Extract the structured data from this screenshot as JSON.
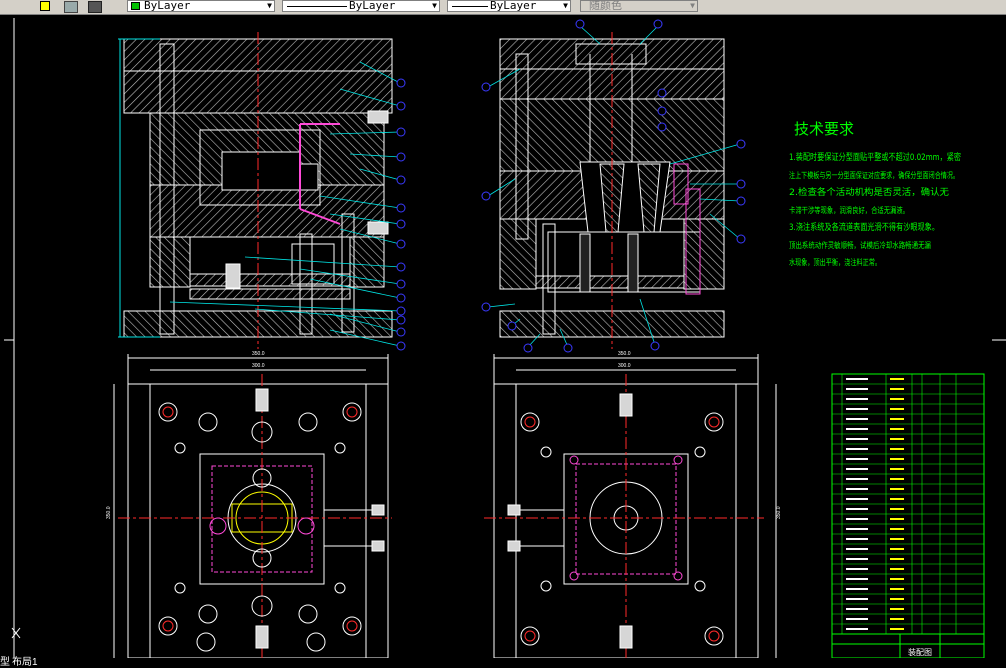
{
  "toolbar": {
    "color_combo": "ByLayer",
    "linetype_combo": "ByLayer",
    "lineweight_combo": "ByLayer",
    "plotstyle_combo": "随颜色"
  },
  "colors": {
    "background": "#000000",
    "outline": "#ffffff",
    "hatch": "#c8c8c8",
    "centerline": "#ff2a2a",
    "leader": "#00e5e5",
    "balloon": "#3a3aff",
    "tech_text": "#00ff00",
    "dimension": "#ffffff",
    "hidden": "#ff4ad8",
    "yellow": "#ffff00"
  },
  "technical_requirements": {
    "title": "技术要求",
    "lines": [
      "1.装配时要保证分型面贴平整或不超过0.02mm，紧密",
      "注上下模板与另一分型面保证对应要求，确保分型面闭合情况。",
      "2.检查各个活动机构是否灵活，确认无",
      "卡滞干涉等现象，润滑良好，合适无漏液。",
      "3.浇注系统及各流道表面光滑不得有沙眼现象。",
      "顶出系统动作灵敏顺畅，试模后冷却水路畅通无漏",
      "水现象，顶出平衡，浇注料正常。"
    ]
  },
  "dimensions": {
    "left_plan_overall": "350.0",
    "left_plan_inner": "300.0",
    "left_plan_height": "350.0",
    "right_plan_overall": "350.0",
    "right_plan_inner": "300.0",
    "right_plan_height": "350.0"
  },
  "title_block": {
    "name_cell": "装配图"
  },
  "status_bar": {
    "model_tab": "型",
    "layout_tab": "布局1"
  }
}
